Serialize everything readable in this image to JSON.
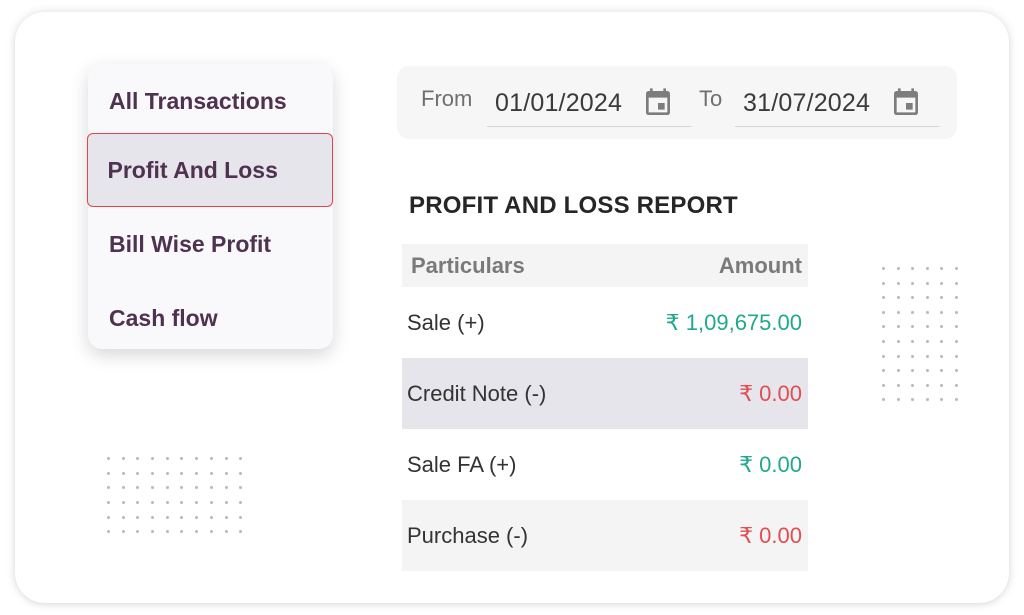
{
  "menu": {
    "items": [
      {
        "label": "All Transactions",
        "active": false
      },
      {
        "label": "Profit And Loss",
        "active": true
      },
      {
        "label": "Bill Wise Profit",
        "active": false
      },
      {
        "label": "Cash flow",
        "active": false
      }
    ]
  },
  "date_filter": {
    "from_label": "From",
    "from_value": "01/01/2024",
    "to_label": "To",
    "to_value": "31/07/2024",
    "icon": "calendar-icon"
  },
  "report": {
    "title": "PROFIT AND LOSS REPORT",
    "columns": [
      "Particulars",
      "Amount"
    ],
    "rows": [
      {
        "particular": "Sale (+)",
        "amount": "₹ 1,09,675.00",
        "type": "positive"
      },
      {
        "particular": "Credit Note (-)",
        "amount": "₹ 0.00",
        "type": "negative"
      },
      {
        "particular": "Sale FA (+)",
        "amount": "₹ 0.00",
        "type": "positive"
      },
      {
        "particular": "Purchase (-)",
        "amount": "₹ 0.00",
        "type": "negative"
      }
    ]
  },
  "colors": {
    "menu_text": "#4f3150",
    "active_border": "#e0454c",
    "positive": "#21a88f",
    "negative": "#e24d52"
  }
}
